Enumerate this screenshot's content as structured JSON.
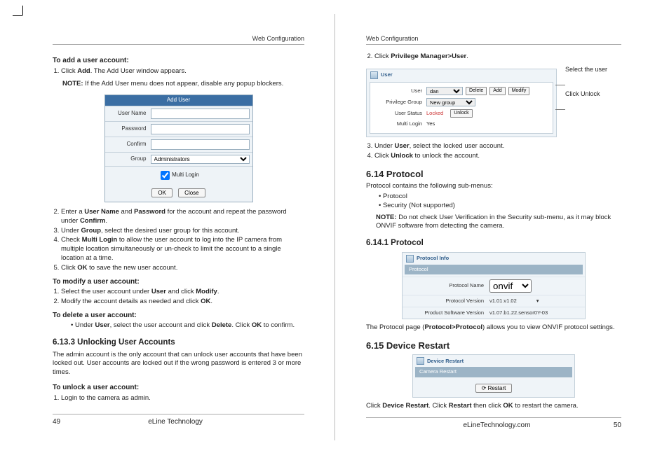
{
  "left": {
    "running": "Web Configuration",
    "pageNumber": "49",
    "footerBrand": "eLine Technology",
    "addTitle": "To add a user account:",
    "addStep1_a": "Click ",
    "addStep1_bold": "Add",
    "addStep1_b": ". The Add User window appears.",
    "note1_label": "NOTE:",
    "note1_text": " If the Add User menu does not appear, disable any popup blockers.",
    "dlg": {
      "title": "Add User",
      "username": "User Name",
      "password": "Password",
      "confirm": "Confirm",
      "group": "Group",
      "groupOpt": "Administrators",
      "multi": "Multi Login",
      "ok": "OK",
      "close": "Close"
    },
    "step2_a": "Enter a ",
    "step2_b1": "User Name",
    "step2_b": " and ",
    "step2_b2": "Password",
    "step2_c": " for the account and repeat the password under ",
    "step2_b3": "Confirm",
    "step2_d": ".",
    "step3_a": "Under ",
    "step3_b": "Group",
    "step3_c": ", select the desired user group for this account.",
    "step4_a": "Check ",
    "step4_b": "Multi Login",
    "step4_c": " to allow the user account to log into the IP camera from multiple location simultaneously or un-check to limit the account to a single location at a time.",
    "step5_a": "Click ",
    "step5_b": "OK",
    "step5_c": " to save the new user account.",
    "modTitle": "To modify a user account:",
    "mod1_a": "Select the user account under ",
    "mod1_b": "User",
    "mod1_c": " and click ",
    "mod1_d": "Modify",
    "mod1_e": ".",
    "mod2_a": "Modify the account details as needed and click ",
    "mod2_b": "OK",
    "mod2_c": ".",
    "delTitle": "To delete a user account:",
    "del1_a": "Under ",
    "del1_b": "User",
    "del1_c": ", select the user account and click ",
    "del1_d": "Delete",
    "del1_e": ". Click ",
    "del1_f": "OK",
    "del1_g": " to confirm.",
    "unlockHdr": "6.13.3 Unlocking User Accounts",
    "unlockBody": "The admin account is the only account that can unlock user accounts that have been locked out. User accounts are locked out if the wrong password is entered 3 or more times.",
    "unlockTitle": "To unlock a user account:",
    "unlock1": "Login to the camera as admin."
  },
  "right": {
    "running": "Web Configuration",
    "pageNumber": "50",
    "footerBrand": "eLineTechnology.com",
    "step2_a": "Click ",
    "step2_b": "Privilege Manager>User",
    "step2_c": ".",
    "userTab": {
      "tabLabel": "User",
      "userLbl": "User",
      "userVal": "dan",
      "btnDelete": "Delete",
      "btnAdd": "Add",
      "btnModify": "Modify",
      "privLbl": "Privilege Group",
      "privVal": "New group",
      "statusLbl": "User Status",
      "statusVal": "Locked",
      "btnUnlock": "Unlock",
      "multiLbl": "Multi Login",
      "multiVal": "Yes"
    },
    "callout1": "Select the user",
    "callout2": "Click Unlock",
    "step3_a": "Under ",
    "step3_b": "User",
    "step3_c": ", select the locked user account.",
    "step4_a": "Click ",
    "step4_b": "Unlock",
    "step4_c": " to unlock the account.",
    "s614": "6.14  Protocol",
    "s614_intro": "Protocol contains the following sub-menus:",
    "s614_i1": "Protocol",
    "s614_i2": "Security (Not supported)",
    "s614_note_label": "NOTE:",
    "s614_note": " Do not check User Verification in the Security sub-menu, as it may block ONVIF software from detecting the camera.",
    "s6141": "6.14.1 Protocol",
    "proto": {
      "tabLabel": "Protocol Info",
      "hbar": "Protocol",
      "pnameLbl": "Protocol Name",
      "pnameVal": "onvif",
      "pverLbl": "Protocol Version",
      "pverVal": "v1.01.v1.02",
      "pswLbl": "Product Software Version",
      "pswVal": "v1.07.b1.22.sensor0Y-03"
    },
    "protoText_a": "The Protocol page (",
    "protoText_b": "Protocol>Protocol",
    "protoText_c": ") allows you to view ONVIF protocol settings.",
    "s615": "6.15  Device Restart",
    "restart": {
      "tabLabel": "Device Restart",
      "hbar": "Camera Restart",
      "btn": "Restart"
    },
    "restartText_a": "Click ",
    "restartText_b": "Device Restart",
    "restartText_c": ". Click ",
    "restartText_d": "Restart",
    "restartText_e": " then click ",
    "restartText_f": "OK",
    "restartText_g": " to restart the camera."
  }
}
